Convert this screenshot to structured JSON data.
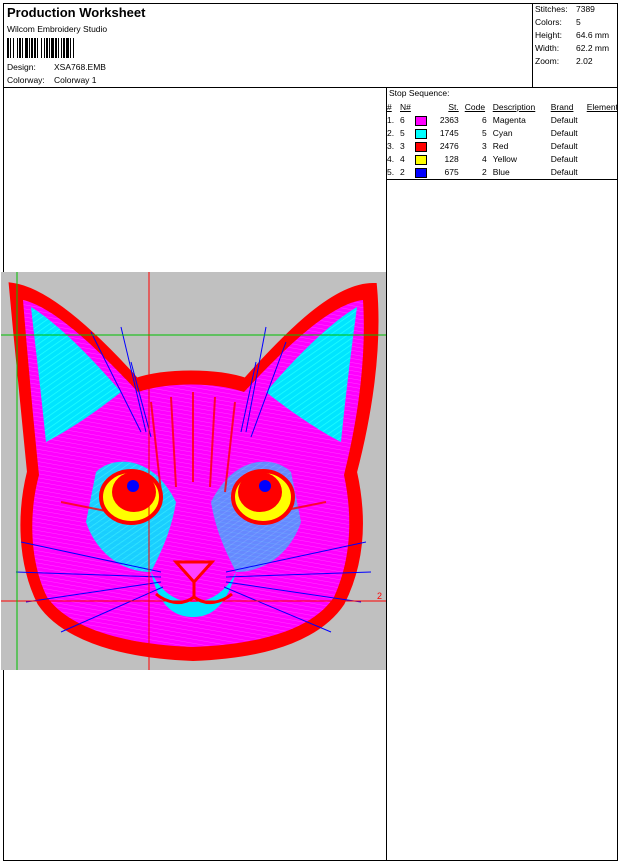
{
  "header": {
    "title": "Production Worksheet",
    "software": "Wilcom  Embroidery Studio",
    "design_label": "Design:",
    "design_value": "XSA768.EMB",
    "colorway_label": "Colorway:",
    "colorway_value": "Colorway 1"
  },
  "stats": [
    {
      "label": "Stitches:",
      "value": "7389"
    },
    {
      "label": "Colors:",
      "value": "5"
    },
    {
      "label": "Height:",
      "value": "64.6 mm"
    },
    {
      "label": "Width:",
      "value": "62.2 mm"
    },
    {
      "label": "Zoom:",
      "value": "2.02"
    }
  ],
  "stop_sequence": {
    "title": "Stop Sequence:",
    "columns": [
      "#",
      "N#",
      "St.",
      "Code",
      "Description",
      "Brand",
      "Element"
    ],
    "rows": [
      {
        "num": "1.",
        "n": "6",
        "color": "#ff00ff",
        "st": "2363",
        "code": "6",
        "desc": "Magenta",
        "brand": "Default",
        "element": ""
      },
      {
        "num": "2.",
        "n": "5",
        "color": "#00ffff",
        "st": "1745",
        "code": "5",
        "desc": "Cyan",
        "brand": "Default",
        "element": ""
      },
      {
        "num": "3.",
        "n": "3",
        "color": "#ff0000",
        "st": "2476",
        "code": "3",
        "desc": "Red",
        "brand": "Default",
        "element": ""
      },
      {
        "num": "4.",
        "n": "4",
        "color": "#ffff00",
        "st": "128",
        "code": "4",
        "desc": "Yellow",
        "brand": "Default",
        "element": ""
      },
      {
        "num": "5.",
        "n": "2",
        "color": "#0000ff",
        "st": "675",
        "code": "2",
        "desc": "Blue",
        "brand": "Default",
        "element": ""
      }
    ]
  },
  "preview": {
    "background": "#c0c0c0",
    "marker_label": "2"
  }
}
